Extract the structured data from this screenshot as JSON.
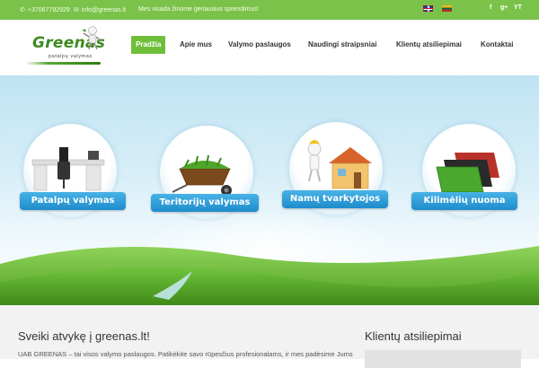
{
  "topbar": {
    "phone": "+37067792929",
    "email": "info@greenas.lt",
    "tagline": "Mes visada žinome geriausius sprendimus!",
    "languages": [
      "en-flag",
      "lt-flag"
    ],
    "social": [
      "f",
      "g+",
      "YT"
    ]
  },
  "logo": {
    "name": "Greenas",
    "subtitle": "patalpų valymas"
  },
  "nav": {
    "items": [
      {
        "label": "Pradžia",
        "active": true
      },
      {
        "label": "Apie mus",
        "active": false
      },
      {
        "label": "Valymo paslaugos",
        "active": false
      },
      {
        "label": "Naudingi straipsniai",
        "active": false
      },
      {
        "label": "Klientų atsiliepimai",
        "active": false
      },
      {
        "label": "Kontaktai",
        "active": false
      }
    ]
  },
  "hero": {
    "services": [
      {
        "label": "Patalpų valymas",
        "icon": "office-desk-icon"
      },
      {
        "label": "Teritorijų valymas",
        "icon": "wheelbarrow-icon"
      },
      {
        "label": "Namų tvarkytojos",
        "icon": "house-icon"
      },
      {
        "label": "Kilimėlių nuoma",
        "icon": "mats-icon"
      }
    ]
  },
  "content": {
    "welcome_title": "Sveiki atvykę į greenas.lt!",
    "welcome_text": "UAB GREENAS – tai visos valymo paslaugos. Patikėkite savo rūpesčius profesionalams, ir mes padėsime Jums",
    "reviews_title": "Klientų atsiliepimai"
  },
  "colors": {
    "topbar": "#7bc24a",
    "nav_active": "#6fbf3b",
    "banner": "#2a9ad8"
  }
}
